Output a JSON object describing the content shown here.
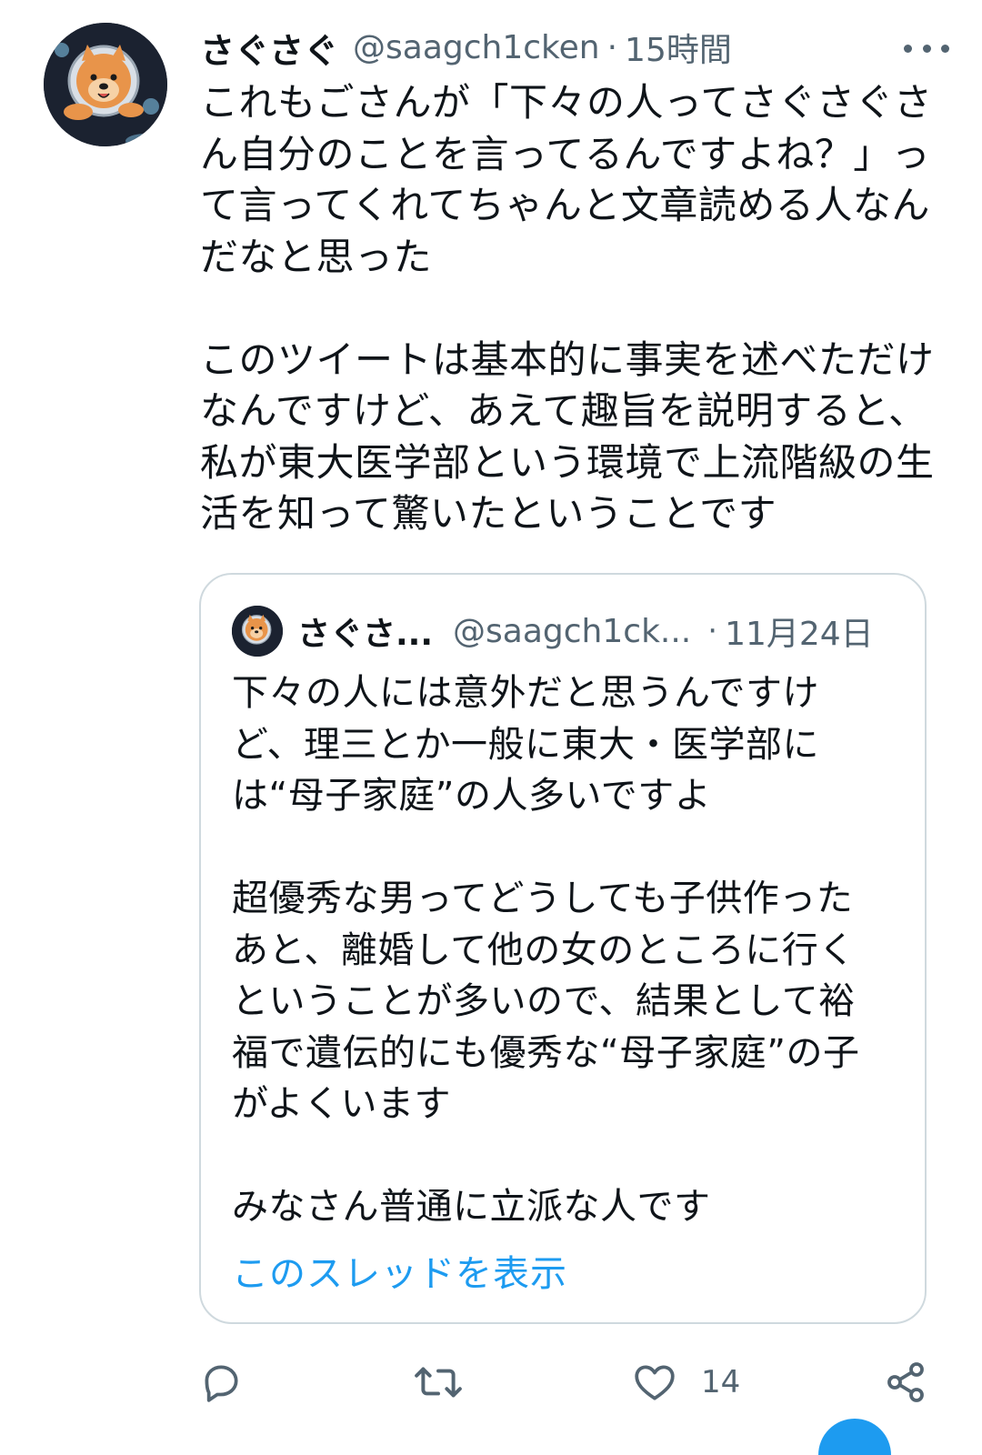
{
  "tweet": {
    "author_name": "さぐさぐ",
    "author_handle": "@saagch1cken",
    "separator": "·",
    "time": "15時間",
    "text": "これもごさんが「下々の人ってさぐさぐさん自分のことを言ってるんですよね？」って言ってくれてちゃんと文章読める人なんだなと思った\n\nこのツイートは基本的に事実を述べただけなんですけど、あえて趣旨を説明すると、私が東大医学部という環境で上流階級の生活を知って驚いたということです"
  },
  "quoted_tweet": {
    "author_name": "さぐさ...",
    "author_handle": "@saagch1ck...",
    "separator": "·",
    "time": "11月24日",
    "text": "下々の人には意外だと思うんですけど、理三とか一般に東大・医学部には“母子家庭”の人多いですよ\n\n超優秀な男ってどうしても子供作ったあと、離婚して他の女のところに行くということが多いので、結果として裕福で遺伝的にも優秀な“母子家庭”の子がよくいます\n\nみなさん普通に立派な人です",
    "show_thread": "このスレッドを表示"
  },
  "actions": {
    "like_count": "14"
  },
  "icons": {
    "reply": "reply-icon",
    "retweet": "retweet-icon",
    "like": "heart-icon",
    "share": "share-icon",
    "more": "more-icon"
  },
  "colors": {
    "text": "#0f1419",
    "secondary": "#536471",
    "link": "#1d9bf0",
    "border": "#cfd9de"
  }
}
